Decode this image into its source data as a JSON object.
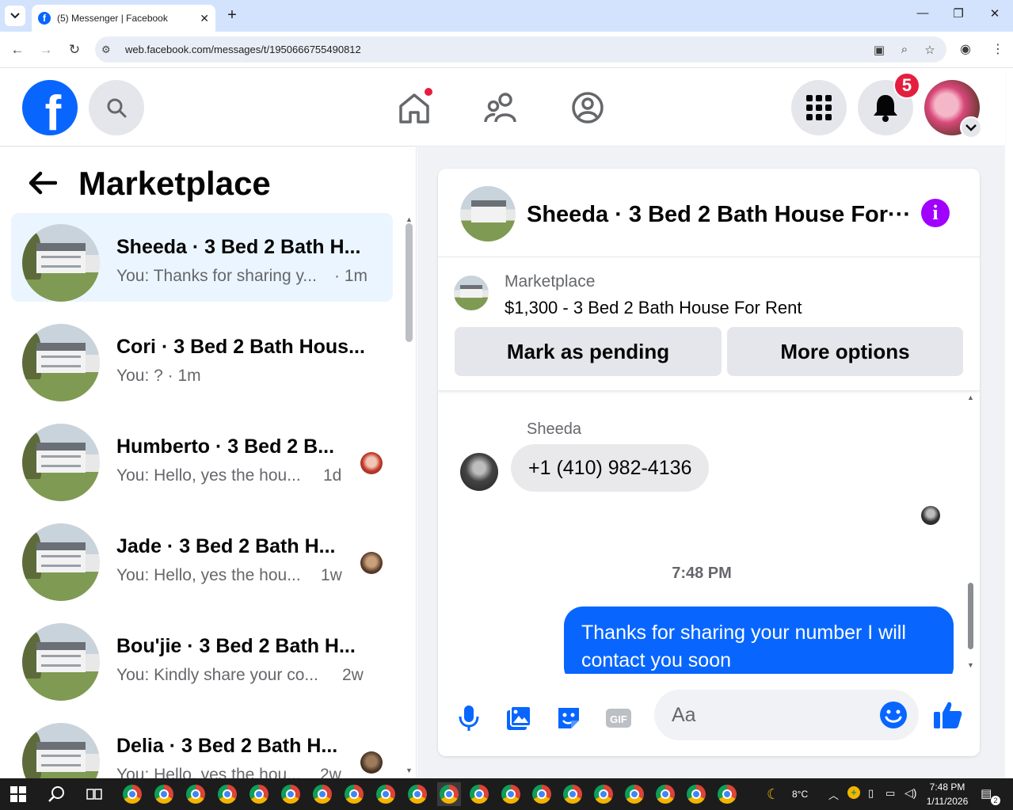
{
  "browser": {
    "tab_title": "(5) Messenger | Facebook",
    "url": "web.facebook.com/messages/t/1950666755490812"
  },
  "header": {
    "notification_count": "5"
  },
  "sidebar": {
    "title": "Marketplace",
    "conversations": [
      {
        "name": "Sheeda · 3 Bed 2 Bath H...",
        "preview": "You: Thanks for sharing y...",
        "time": "· 1m",
        "active": true
      },
      {
        "name": "Cori · 3 Bed 2 Bath Hous...",
        "preview": "You: ? · 1m",
        "time": "",
        "active": false
      },
      {
        "name": "Humberto · 3 Bed 2 B...",
        "preview": "You: Hello, yes the hou...",
        "time": "1d",
        "active": false
      },
      {
        "name": "Jade · 3 Bed 2 Bath H...",
        "preview": "You: Hello, yes the hou...",
        "time": "1w",
        "active": false
      },
      {
        "name": "Bou'jie · 3 Bed 2 Bath H...",
        "preview": "You: Kindly share your co...",
        "time": "2w",
        "active": false
      },
      {
        "name": "Delia · 3 Bed 2 Bath H...",
        "preview": "You: Hello, yes the hou...",
        "time": "2w",
        "active": false
      }
    ]
  },
  "chat": {
    "title": "Sheeda · 3 Bed 2 Bath House For···",
    "listing": {
      "source": "Marketplace",
      "title": "$1,300 - 3 Bed 2 Bath House For Rent",
      "mark_pending_label": "Mark as pending",
      "more_options_label": "More options"
    },
    "messages": {
      "sender": "Sheeda",
      "received_text": "+1 (410) 982-4136",
      "timestamp": "7:48 PM",
      "sent_text": "Thanks for sharing your number I will contact you soon"
    },
    "composer": {
      "placeholder": "Aa"
    }
  },
  "taskbar": {
    "weather": "8°C",
    "time": "7:48 PM",
    "date": "1/11/2026",
    "notifications": "2"
  },
  "colors": {
    "brand": "#0866ff",
    "active_item_bg": "#ebf5ff",
    "notification_red": "#e41e3f",
    "info_purple": "#a100ff"
  }
}
